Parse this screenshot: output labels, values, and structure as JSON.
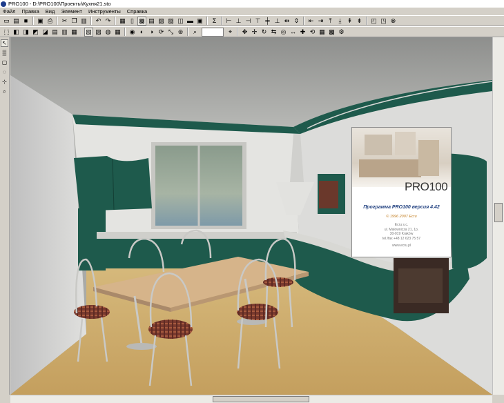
{
  "window": {
    "title": "PRO100 - D:\\PRO100\\Проекты\\Кухня21.sto"
  },
  "menu": [
    "Файл",
    "Правка",
    "Вид",
    "Элемент",
    "Инструменты",
    "Справка"
  ],
  "toolbar1": [
    {
      "name": "new-icon",
      "glyph": "▭"
    },
    {
      "name": "open-icon",
      "glyph": "▤"
    },
    {
      "name": "save-icon",
      "glyph": "■"
    },
    {
      "sep": true
    },
    {
      "name": "print-preview-icon",
      "glyph": "▣"
    },
    {
      "name": "print-icon",
      "glyph": "⎙"
    },
    {
      "sep": true
    },
    {
      "name": "cut-icon",
      "glyph": "✂"
    },
    {
      "name": "copy-icon",
      "glyph": "❐"
    },
    {
      "name": "paste-icon",
      "glyph": "▥"
    },
    {
      "sep": true
    },
    {
      "name": "undo-icon",
      "glyph": "↶"
    },
    {
      "name": "redo-icon",
      "glyph": "↷"
    },
    {
      "sep": true
    },
    {
      "name": "library-icon",
      "glyph": "▦"
    },
    {
      "name": "view-front-icon",
      "glyph": "▯"
    },
    {
      "name": "view-persp-icon",
      "glyph": "▩",
      "on": true
    },
    {
      "name": "view-top-icon",
      "glyph": "▤"
    },
    {
      "name": "view-left-icon",
      "glyph": "▧"
    },
    {
      "name": "view-right-icon",
      "glyph": "▨"
    },
    {
      "name": "view-axon-icon",
      "glyph": "◫"
    },
    {
      "name": "camera-icon",
      "glyph": "▬"
    },
    {
      "name": "light-icon",
      "glyph": "▣"
    },
    {
      "sep": true
    },
    {
      "name": "sum-icon",
      "glyph": "Σ"
    },
    {
      "sep": true
    },
    {
      "name": "align-left-icon",
      "glyph": "⊢"
    },
    {
      "name": "align-center-icon",
      "glyph": "⊥"
    },
    {
      "name": "align-right-icon",
      "glyph": "⊣"
    },
    {
      "name": "align-top-icon",
      "glyph": "⊤"
    },
    {
      "name": "align-middle-icon",
      "glyph": "╪"
    },
    {
      "name": "align-bottom-icon",
      "glyph": "⊥"
    },
    {
      "name": "distribute-h-icon",
      "glyph": "⇹"
    },
    {
      "name": "distribute-v-icon",
      "glyph": "⇕"
    },
    {
      "sep": true
    },
    {
      "name": "snap-left-icon",
      "glyph": "⇤"
    },
    {
      "name": "snap-right-icon",
      "glyph": "⇥"
    },
    {
      "name": "snap-up-icon",
      "glyph": "⤒"
    },
    {
      "name": "snap-down-icon",
      "glyph": "⤓"
    },
    {
      "name": "snap-front-icon",
      "glyph": "⇞"
    },
    {
      "name": "snap-back-icon",
      "glyph": "⇟"
    },
    {
      "sep": true
    },
    {
      "name": "group-icon",
      "glyph": "◰"
    },
    {
      "name": "ungroup-icon",
      "glyph": "◳"
    },
    {
      "name": "stop-icon",
      "glyph": "⊗"
    }
  ],
  "toolbar2": [
    {
      "name": "box-icon",
      "glyph": "⬚"
    },
    {
      "name": "cabinet-icon",
      "glyph": "◧"
    },
    {
      "name": "panel-icon",
      "glyph": "◨"
    },
    {
      "name": "door-icon",
      "glyph": "◩"
    },
    {
      "name": "drawer-icon",
      "glyph": "◪"
    },
    {
      "name": "shelf-icon",
      "glyph": "▤"
    },
    {
      "name": "handle-icon",
      "glyph": "▥"
    },
    {
      "name": "leg-icon",
      "glyph": "▦"
    },
    {
      "sep": true
    },
    {
      "name": "material-icon",
      "glyph": "▧",
      "on": true
    },
    {
      "name": "texture-icon",
      "glyph": "▨"
    },
    {
      "name": "color-icon",
      "glyph": "◍"
    },
    {
      "name": "wireframe-icon",
      "glyph": "▦"
    },
    {
      "sep": true
    },
    {
      "name": "render-icon",
      "glyph": "◉"
    },
    {
      "name": "shade-icon",
      "glyph": "◐"
    },
    {
      "name": "mirror-icon",
      "glyph": "◑"
    },
    {
      "name": "rotate-icon",
      "glyph": "⟳"
    },
    {
      "name": "scale-icon",
      "glyph": "⤡"
    },
    {
      "name": "stop2-icon",
      "glyph": "⊛"
    },
    {
      "sep": true
    },
    {
      "name": "zoom-icon",
      "glyph": "⌕"
    },
    {
      "input": true
    },
    {
      "name": "zoom-fit-icon",
      "glyph": "⌖"
    },
    {
      "sep": true
    },
    {
      "name": "move-icon",
      "glyph": "✥"
    },
    {
      "name": "pan-icon",
      "glyph": "✢"
    },
    {
      "name": "orbit-icon",
      "glyph": "↻"
    },
    {
      "name": "walk-icon",
      "glyph": "⇆"
    },
    {
      "name": "eye-icon",
      "glyph": "◎"
    },
    {
      "name": "measure-icon",
      "glyph": "↔"
    },
    {
      "name": "pin-icon",
      "glyph": "✚"
    },
    {
      "name": "refresh-icon",
      "glyph": "⟲"
    },
    {
      "name": "grid-icon",
      "glyph": "▦"
    },
    {
      "name": "lock-icon",
      "glyph": "▩"
    },
    {
      "name": "settings-icon",
      "glyph": "⚙"
    }
  ],
  "leftbar": [
    {
      "name": "select-arrow-icon",
      "glyph": "↖",
      "on": true
    },
    {
      "name": "hatch-icon",
      "glyph": "▒"
    },
    {
      "name": "rect-select-icon",
      "glyph": "▢"
    },
    {
      "name": "lasso-icon",
      "glyph": "◌"
    },
    {
      "name": "node-icon",
      "glyph": "⊹"
    },
    {
      "name": "magnifier-icon",
      "glyph": "⌕"
    }
  ],
  "splash": {
    "logo": "PRO100",
    "version": "Программа PRO100 версия 4.42",
    "copyright": "© 1996 2007 Ecru",
    "company": "Ecru s.c.",
    "street": "ul. Malowniczа 21, 1p.",
    "city": "30-019 Kraków",
    "phone": "tel./fax +48 12 623 75 57",
    "web": "www.ecru.pl"
  },
  "colors": {
    "cabinet_green": "#1e5a4c",
    "splash_blue": "#1f3f7f",
    "splash_orange": "#c07a1a"
  }
}
